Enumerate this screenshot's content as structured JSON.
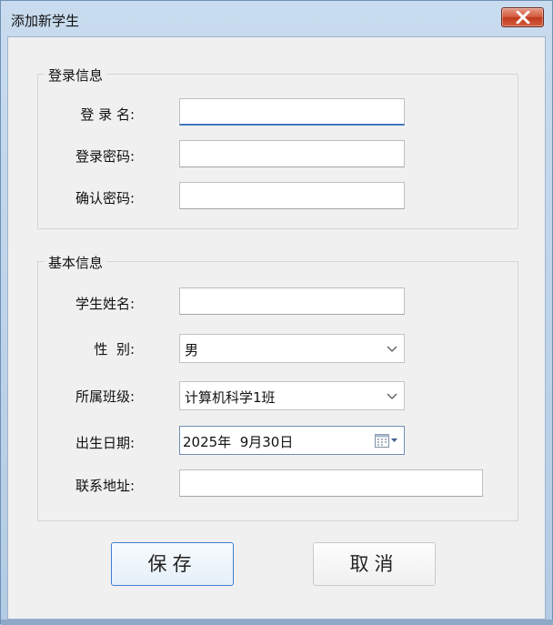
{
  "window": {
    "title": "添加新学生"
  },
  "login_group": {
    "title": "登录信息",
    "username_label": "登 录 名:",
    "password_label": "登录密码:",
    "confirm_label": "确认密码:",
    "username_value": "",
    "password_value": "",
    "confirm_value": ""
  },
  "basic_group": {
    "title": "基本信息",
    "name_label": "学生姓名:",
    "gender_label": "性  别:",
    "gender_value": "男",
    "class_label": "所属班级:",
    "class_value": "计算机科学1班",
    "birth_label": "出生日期:",
    "birth_value": "2025年  9月30日",
    "address_label": "联系地址:",
    "name_value": "",
    "address_value": ""
  },
  "buttons": {
    "save": "保存",
    "cancel": "取消"
  },
  "icons": {
    "close": "close-x-icon",
    "dropdown": "chevron-down-icon",
    "calendar": "calendar-icon"
  },
  "colors": {
    "accent": "#3f78bc",
    "close": "#c1391d"
  }
}
